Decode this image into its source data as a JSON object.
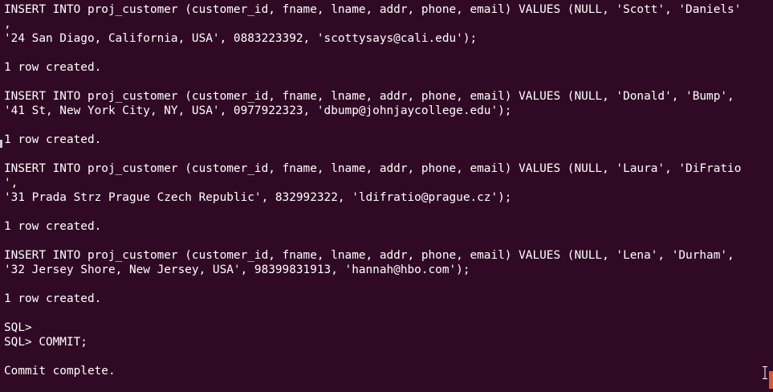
{
  "terminal": {
    "lines": [
      "INSERT INTO proj_customer (customer_id, fname, lname, addr, phone, email) VALUES (NULL, 'Scott', 'Daniels'",
      ",",
      "'24 San Diago, California, USA', 0883223392, 'scottysays@cali.edu');",
      "",
      "1 row created.",
      "",
      "INSERT INTO proj_customer (customer_id, fname, lname, addr, phone, email) VALUES (NULL, 'Donald', 'Bump',",
      "'41 St, New York City, NY, USA', 0977922323, 'dbump@johnjaycollege.edu');",
      "",
      "1 row created.",
      "",
      "INSERT INTO proj_customer (customer_id, fname, lname, addr, phone, email) VALUES (NULL, 'Laura', 'DiFratio",
      "',",
      "'31 Prada Strz Prague Czech Republic', 832992322, 'ldifratio@prague.cz');",
      "",
      "1 row created.",
      "",
      "INSERT INTO proj_customer (customer_id, fname, lname, addr, phone, email) VALUES (NULL, 'Lena', 'Durham',",
      "'32 Jersey Shore, New Jersey, USA', 98399831913, 'hannah@hbo.com');",
      "",
      "1 row created.",
      "",
      "SQL>",
      "SQL> COMMIT;",
      "",
      "Commit complete."
    ]
  },
  "colors": {
    "background": "#300a24",
    "foreground": "#ffffff",
    "cursor": "#e95420"
  },
  "icons": {
    "mouse_cursor": "text-ibeam-icon"
  }
}
